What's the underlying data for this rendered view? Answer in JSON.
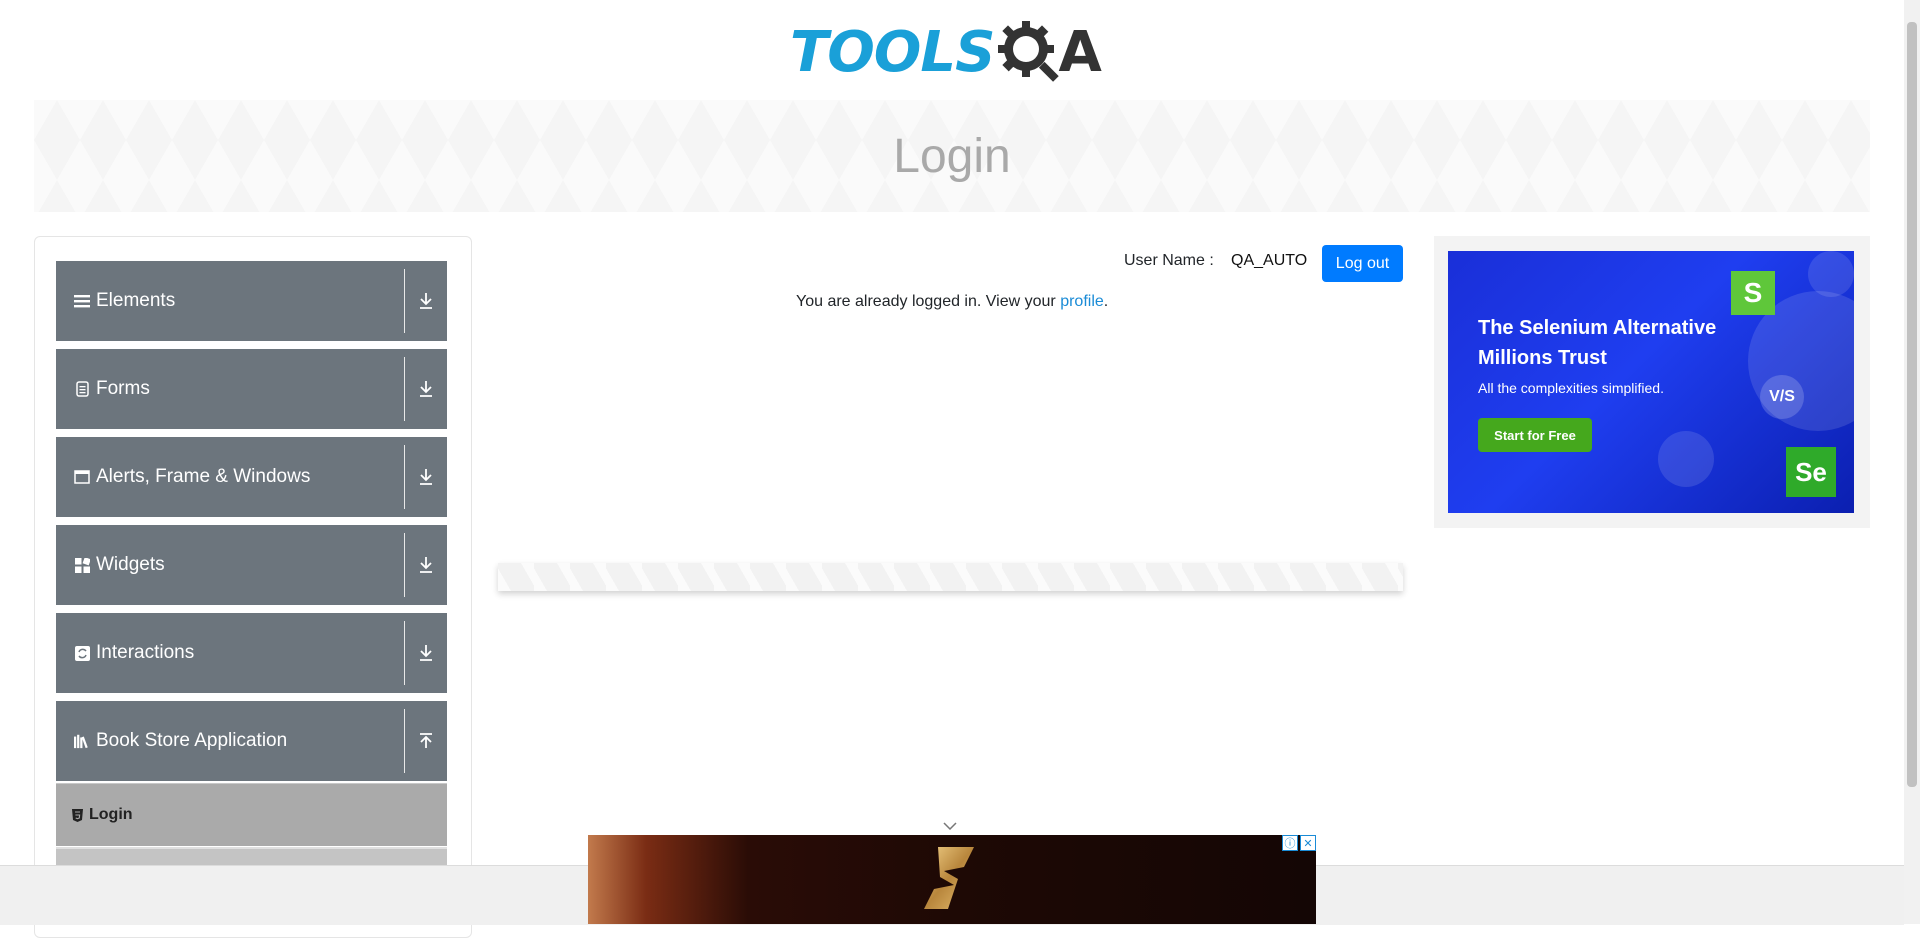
{
  "header": {
    "logo_text_left": "TOOLS",
    "logo_text_right": "A",
    "banner_title": "Login"
  },
  "sidebar": {
    "groups": [
      {
        "label": "Elements",
        "icon": "hamburger-icon",
        "expanded": false
      },
      {
        "label": "Forms",
        "icon": "document-icon",
        "expanded": false
      },
      {
        "label": "Alerts, Frame & Windows",
        "icon": "window-icon",
        "expanded": false
      },
      {
        "label": "Widgets",
        "icon": "widgets-icon",
        "expanded": false
      },
      {
        "label": "Interactions",
        "icon": "interactions-icon",
        "expanded": false
      },
      {
        "label": "Book Store Application",
        "icon": "books-icon",
        "expanded": true
      }
    ],
    "sub_items": [
      {
        "label": "Login",
        "icon": "html5-icon",
        "active": true
      }
    ]
  },
  "main": {
    "user_name_label": "User Name :",
    "user_name_value": "QA_AUTO",
    "logout_label": "Log out",
    "message_prefix": "You are already logged in. View your ",
    "message_link": "profile",
    "message_suffix": "."
  },
  "ad_right": {
    "headline_line1": "The Selenium Alternative",
    "headline_line2": "Millions Trust",
    "subtext": "All the complexities simplified.",
    "cta": "Start for Free",
    "badge_s": "S",
    "badge_se": "Se",
    "badge_vs": "V/S"
  },
  "colors": {
    "sidebar_group_bg": "#6c757d",
    "sidebar_active_bg": "#aaaaaa",
    "logout_button": "#007bff",
    "link": "#1a8bd6",
    "logo_blue": "#1aa0d8"
  }
}
